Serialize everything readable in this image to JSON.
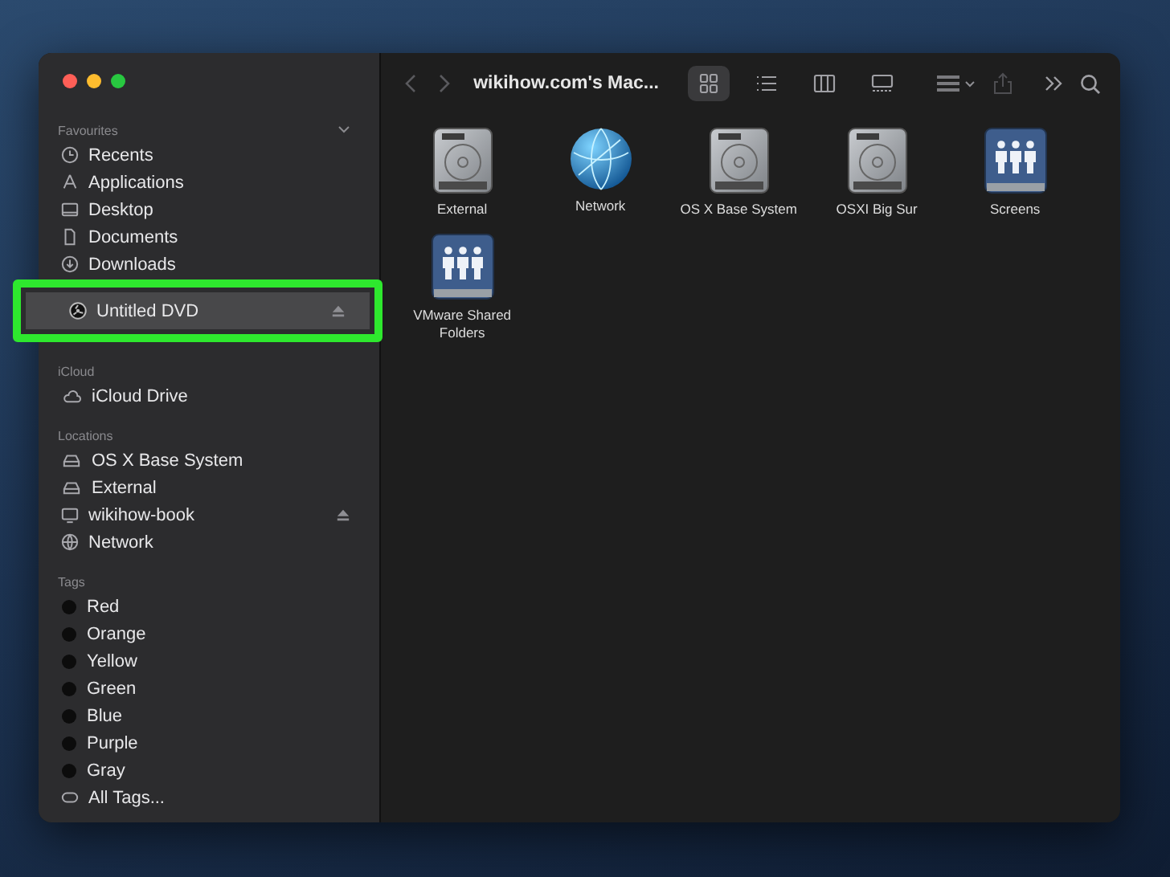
{
  "window": {
    "title": "wikihow.com's Mac..."
  },
  "sidebar": {
    "sections": [
      {
        "heading": "Favourites",
        "collapsible": true,
        "items": [
          {
            "label": "Recents",
            "kind": "clock",
            "selected": false,
            "ejectable": false,
            "highlighted": false
          },
          {
            "label": "Applications",
            "kind": "apps",
            "selected": false,
            "ejectable": false,
            "highlighted": false
          },
          {
            "label": "Desktop",
            "kind": "desktop",
            "selected": false,
            "ejectable": false,
            "highlighted": false
          },
          {
            "label": "Documents",
            "kind": "document",
            "selected": false,
            "ejectable": false,
            "highlighted": false
          },
          {
            "label": "Downloads",
            "kind": "download",
            "selected": false,
            "ejectable": false,
            "highlighted": false
          },
          {
            "label": "Untitled DVD",
            "kind": "disc",
            "selected": true,
            "ejectable": true,
            "highlighted": true
          }
        ]
      },
      {
        "heading": "iCloud",
        "collapsible": false,
        "items": [
          {
            "label": "iCloud Drive",
            "kind": "cloud",
            "selected": false,
            "ejectable": false,
            "highlighted": false
          }
        ]
      },
      {
        "heading": "Locations",
        "collapsible": false,
        "items": [
          {
            "label": "OS X Base System",
            "kind": "drive",
            "selected": false,
            "ejectable": false,
            "highlighted": false
          },
          {
            "label": "External",
            "kind": "drive",
            "selected": false,
            "ejectable": false,
            "highlighted": false
          },
          {
            "label": "wikihow-book",
            "kind": "computer",
            "selected": false,
            "ejectable": true,
            "highlighted": false
          },
          {
            "label": "Network",
            "kind": "globe",
            "selected": false,
            "ejectable": false,
            "highlighted": false
          }
        ]
      },
      {
        "heading": "Tags",
        "collapsible": false,
        "items": [
          {
            "label": "Red",
            "kind": "tag",
            "selected": false,
            "ejectable": false,
            "highlighted": false
          },
          {
            "label": "Orange",
            "kind": "tag",
            "selected": false,
            "ejectable": false,
            "highlighted": false
          },
          {
            "label": "Yellow",
            "kind": "tag",
            "selected": false,
            "ejectable": false,
            "highlighted": false
          },
          {
            "label": "Green",
            "kind": "tag",
            "selected": false,
            "ejectable": false,
            "highlighted": false
          },
          {
            "label": "Blue",
            "kind": "tag",
            "selected": false,
            "ejectable": false,
            "highlighted": false
          },
          {
            "label": "Purple",
            "kind": "tag",
            "selected": false,
            "ejectable": false,
            "highlighted": false
          },
          {
            "label": "Gray",
            "kind": "tag",
            "selected": false,
            "ejectable": false,
            "highlighted": false
          },
          {
            "label": "All Tags...",
            "kind": "alltags",
            "selected": false,
            "ejectable": false,
            "highlighted": false
          }
        ]
      }
    ]
  },
  "toolbar": {
    "views": [
      {
        "kind": "icons",
        "selected": true
      },
      {
        "kind": "list",
        "selected": false
      },
      {
        "kind": "columns",
        "selected": false
      },
      {
        "kind": "gallery",
        "selected": false
      }
    ]
  },
  "files": [
    {
      "name": "External",
      "kind": "drive"
    },
    {
      "name": "Network",
      "kind": "globe"
    },
    {
      "name": "OS X Base System",
      "kind": "drive"
    },
    {
      "name": "OSXI Big Sur",
      "kind": "drive"
    },
    {
      "name": "Screens",
      "kind": "shared"
    },
    {
      "name": "VMware Shared Folders",
      "kind": "shared"
    }
  ]
}
